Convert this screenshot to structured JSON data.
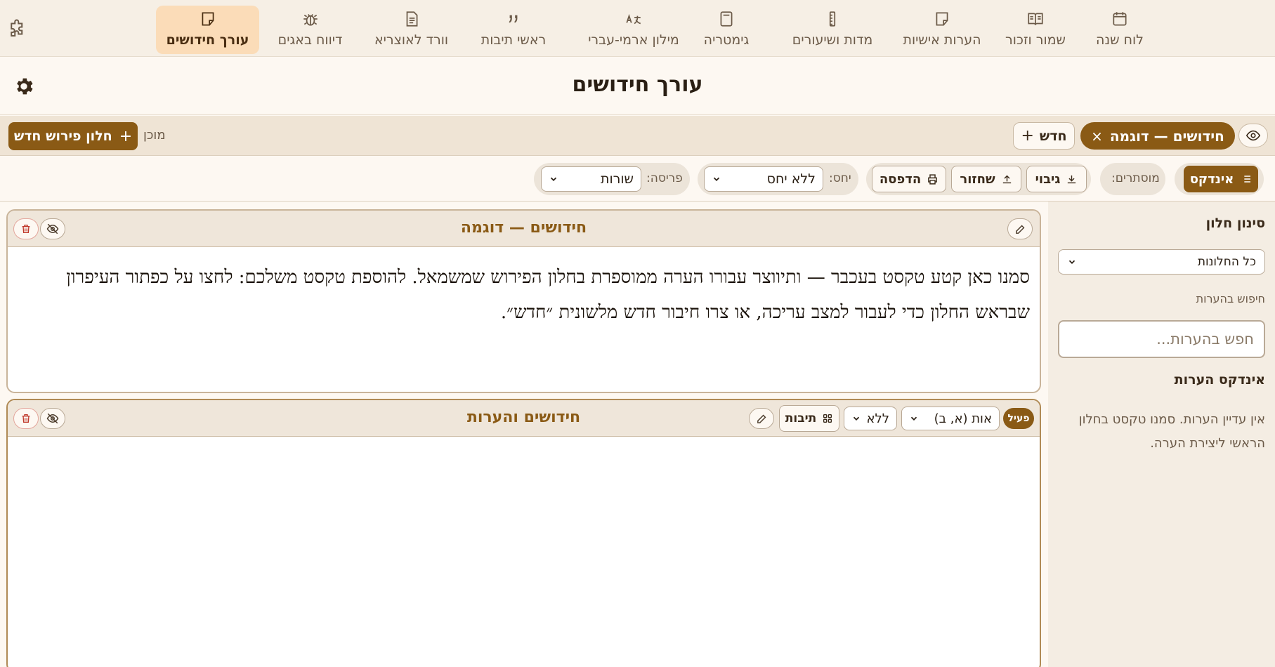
{
  "nav": {
    "items": [
      {
        "label": "עורך חידושים",
        "icon": "note-icon"
      },
      {
        "label": "דיווח באגים",
        "icon": "bug-icon"
      },
      {
        "label": "וורד לאוצריא",
        "icon": "document-icon"
      },
      {
        "label": "ראשי תיבות",
        "icon": "quote-icon"
      },
      {
        "label": "מילון ארמי-עברי",
        "icon": "translate-icon"
      },
      {
        "label": "גימטריה",
        "icon": "calculator-icon"
      },
      {
        "label": "מדות ושיעורים",
        "icon": "ruler-icon"
      },
      {
        "label": "הערות אישיות",
        "icon": "note-icon"
      },
      {
        "label": "שמור וזכור",
        "icon": "book-icon"
      },
      {
        "label": "לוח שנה",
        "icon": "calendar-icon"
      }
    ]
  },
  "header": {
    "title": "עורך חידושים"
  },
  "tabbar": {
    "active_tab": "חידושים — דוגמה",
    "new_label": "חדש",
    "status": "מוכן",
    "new_window_label": "חלון פירוש חדש"
  },
  "toolbar": {
    "index_label": "אינדקס",
    "hidden_label": "מוסתרים:",
    "backup_label": "גיבוי",
    "restore_label": "שחזור",
    "print_label": "הדפסה",
    "relation_label": "יחס:",
    "relation_value": "ללא יחס",
    "layout_label": "פריסה:",
    "layout_value": "שורות"
  },
  "main_panel": {
    "title": "חידושים — דוגמה",
    "text": "סמנו כאן קטע טקסט בעכבר — ותיווצר עבורו הערה ממוספרת בחלון הפירוש שמשמאל. להוספת טקסט משלכם: לחצו על כפתור העיפרון שבראש החלון כדי לעבור למצב עריכה, או צרו חיבור חדש מלשונית ״חדש״."
  },
  "notes_panel": {
    "title": "חידושים והערות",
    "active_badge": "פעיל",
    "numbering_value": "אות (א, ב)",
    "format_value": "ללא",
    "words_label": "תיבות"
  },
  "sidebar": {
    "filter_heading": "סינון חלון",
    "filter_value": "כל החלונות",
    "search_label": "חיפוש בהערות",
    "search_placeholder": "חפש בהערות...",
    "index_heading": "אינדקס הערות",
    "empty_text": "אין עדיין הערות. סמנו טקסט בחלון הראשי ליצירת הערה."
  },
  "colors": {
    "accent": "#8a5a15",
    "active_nav_bg": "#fbdcb8",
    "background": "#fdf8f2"
  }
}
